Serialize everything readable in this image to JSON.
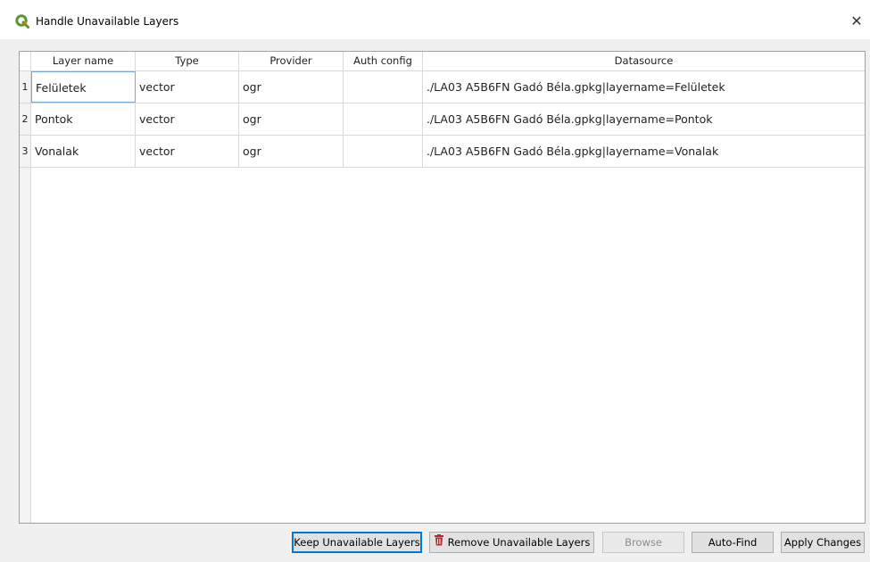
{
  "window": {
    "title": "Handle Unavailable Layers",
    "icon": "qgis-logo-icon",
    "close_glyph": "✕"
  },
  "table": {
    "columns": [
      "Layer name",
      "Type",
      "Provider",
      "Auth config",
      "Datasource"
    ],
    "rows": [
      {
        "num": "1",
        "name": "Felületek",
        "type": "vector",
        "provider": "ogr",
        "auth": "",
        "datasource": "./LA03 A5B6FN Gadó Béla.gpkg|layername=Felületek"
      },
      {
        "num": "2",
        "name": "Pontok",
        "type": "vector",
        "provider": "ogr",
        "auth": "",
        "datasource": "./LA03 A5B6FN Gadó Béla.gpkg|layername=Pontok"
      },
      {
        "num": "3",
        "name": "Vonalak",
        "type": "vector",
        "provider": "ogr",
        "auth": "",
        "datasource": "./LA03 A5B6FN Gadó Béla.gpkg|layername=Vonalak"
      }
    ]
  },
  "buttons": {
    "keep": "Keep Unavailable Layers",
    "remove": "Remove Unavailable Layers",
    "browse": "Browse",
    "autofind": "Auto-Find",
    "apply": "Apply Changes"
  },
  "colors": {
    "accent": "#0078d7",
    "qgis_green": "#589632",
    "qgis_yellow": "#ee7913",
    "trash_red": "#c0262c"
  }
}
